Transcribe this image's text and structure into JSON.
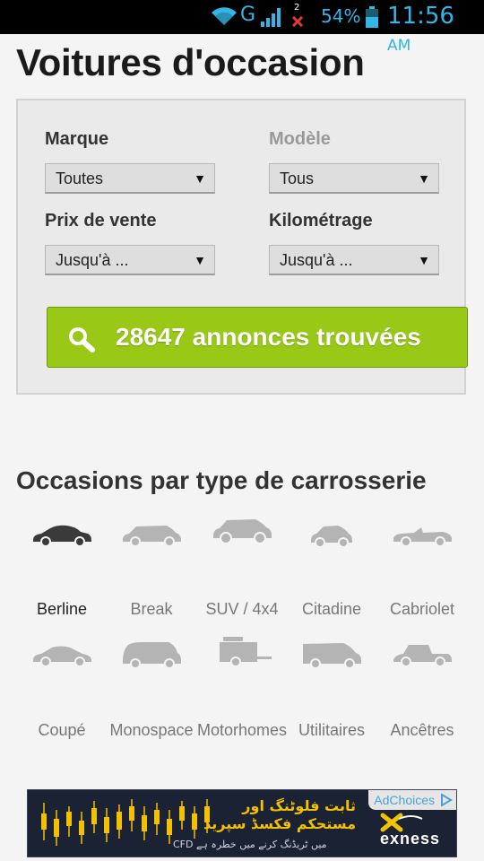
{
  "status_bar": {
    "network": "G",
    "sim_badge": "2",
    "battery": "54%",
    "time": "11:56",
    "ampm": "AM",
    "accent_color": "#33b5e5"
  },
  "page": {
    "title": "Voitures d'occasion"
  },
  "search": {
    "brand_label": "Marque",
    "brand_value": "Toutes",
    "model_label": "Modèle",
    "model_value": "Tous",
    "price_label": "Prix de vente",
    "price_value": "Jusqu'à ...",
    "mileage_label": "Kilométrage",
    "mileage_value": "Jusqu'à ...",
    "arrow": "▼",
    "results_button": "28647 annonces trouvées",
    "button_color": "#99c816"
  },
  "body_types": {
    "title": "Occasions par type de carrosserie",
    "items": [
      {
        "label": "Berline",
        "icon": "sedan-icon",
        "active": true
      },
      {
        "label": "Break",
        "icon": "station-wagon-icon",
        "active": false
      },
      {
        "label": "SUV / 4x4",
        "icon": "suv-icon",
        "active": false
      },
      {
        "label": "Citadine",
        "icon": "city-car-icon",
        "active": false
      },
      {
        "label": "Cabriolet",
        "icon": "convertible-icon",
        "active": false
      },
      {
        "label": "Coupé",
        "icon": "coupe-icon",
        "active": false
      },
      {
        "label": "Monospace",
        "icon": "minivan-icon",
        "active": false
      },
      {
        "label": "Motorhomes",
        "icon": "motorhome-icon",
        "active": false
      },
      {
        "label": "Utilitaires",
        "icon": "van-icon",
        "active": false
      },
      {
        "label": "Ancêtres",
        "icon": "classic-car-icon",
        "active": false
      }
    ]
  },
  "ad": {
    "adchoices": "AdChoices",
    "headline_line1": "ثابت فلوٹنگ اور",
    "headline_line2": "مستحکم فکسڈ سپریڈ",
    "disclaimer": "CFD میں ٹریڈنگ کرنے میں خطرہ ہے",
    "brand": "exness"
  }
}
